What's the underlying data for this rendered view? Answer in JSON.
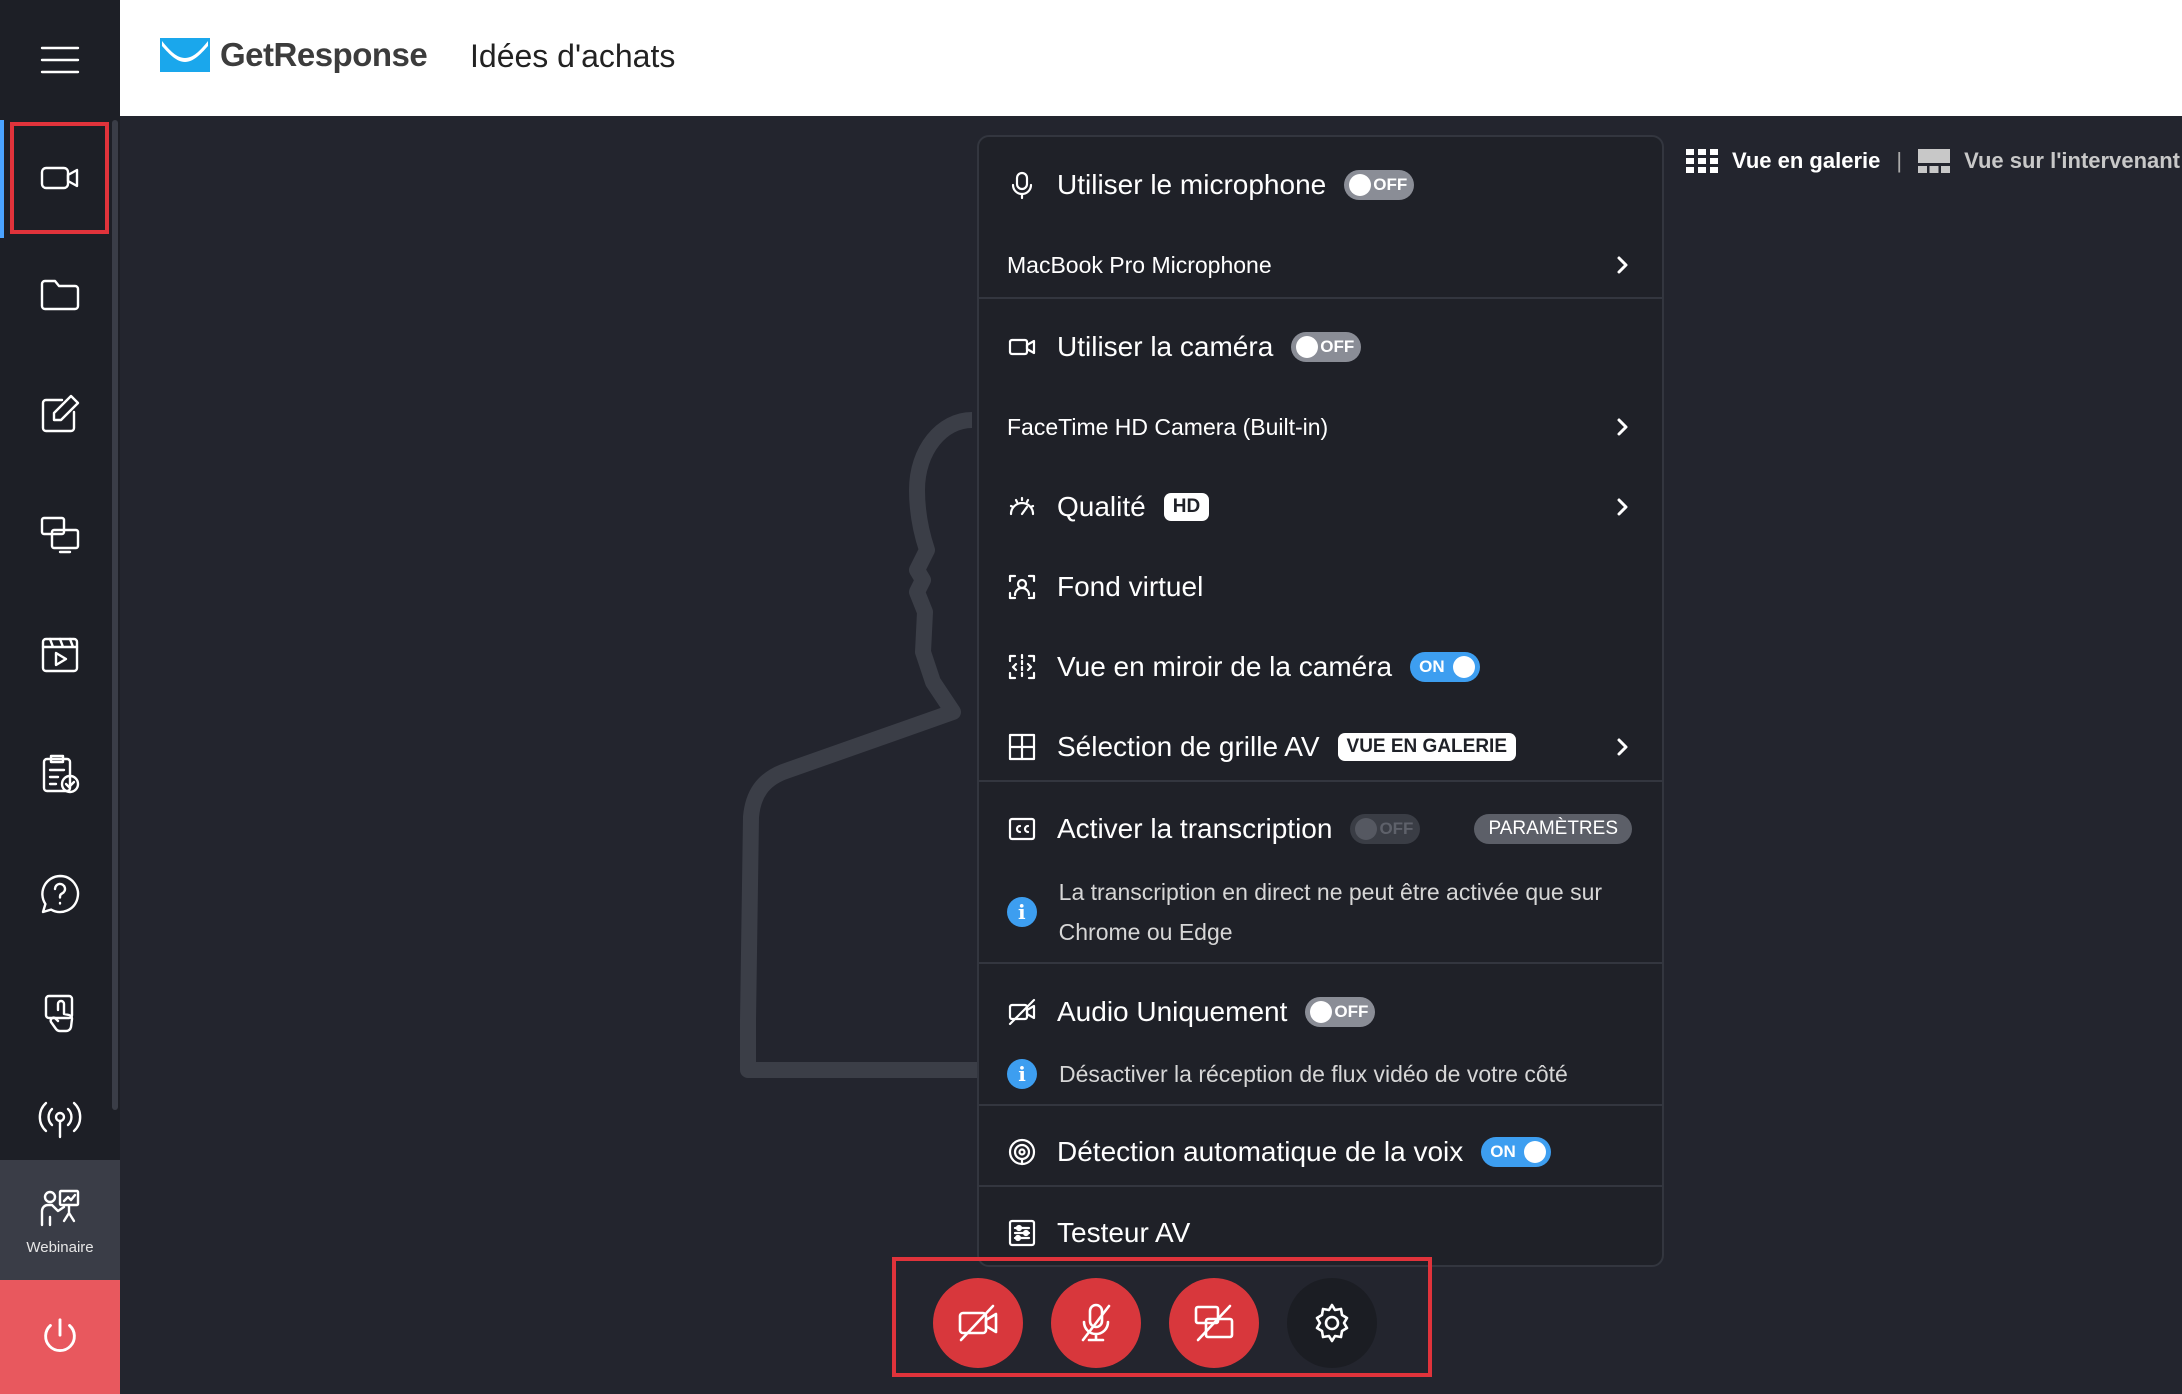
{
  "header": {
    "logo_text": "GetResponse",
    "page_title": "Idées d'achats"
  },
  "sidebar": {
    "items": [
      {
        "icon": "camera-icon",
        "active": true
      },
      {
        "icon": "folder-icon"
      },
      {
        "icon": "edit-icon"
      },
      {
        "icon": "screen-share-icon"
      },
      {
        "icon": "video-play-icon"
      },
      {
        "icon": "checklist-icon"
      },
      {
        "icon": "question-icon"
      },
      {
        "icon": "touch-icon"
      },
      {
        "icon": "broadcast-icon"
      }
    ],
    "webinaire_label": "Webinaire"
  },
  "view_switch": {
    "gallery": "Vue en galerie",
    "separator": "|",
    "speaker": "Vue sur l'intervenant"
  },
  "menu": {
    "microphone": {
      "label": "Utiliser le microphone",
      "toggle": "OFF"
    },
    "microphone_device": "MacBook Pro Microphone",
    "camera": {
      "label": "Utiliser la caméra",
      "toggle": "OFF"
    },
    "camera_device": "FaceTime HD Camera (Built-in)",
    "quality": {
      "label": "Qualité",
      "badge": "HD"
    },
    "virtual_bg": "Fond virtuel",
    "mirror": {
      "label": "Vue en miroir de la caméra",
      "toggle": "ON"
    },
    "grid": {
      "label": "Sélection de grille AV",
      "badge": "VUE EN GALERIE"
    },
    "transcription": {
      "label": "Activer la transcription",
      "toggle": "OFF",
      "settings": "PARAMÈTRES",
      "info": "La transcription en direct ne peut être activée que sur Chrome ou Edge"
    },
    "audio_only": {
      "label": "Audio Uniquement",
      "toggle": "OFF",
      "info": "Désactiver la réception de flux vidéo de votre côté"
    },
    "voice_detection": {
      "label": "Détection automatique de la voix",
      "toggle": "ON"
    },
    "av_tester": "Testeur AV"
  },
  "colors": {
    "accent_blue": "#3d9ef0",
    "alert_red": "#d8373c",
    "highlight_red": "#e0333b",
    "power_red": "#e8585e"
  }
}
